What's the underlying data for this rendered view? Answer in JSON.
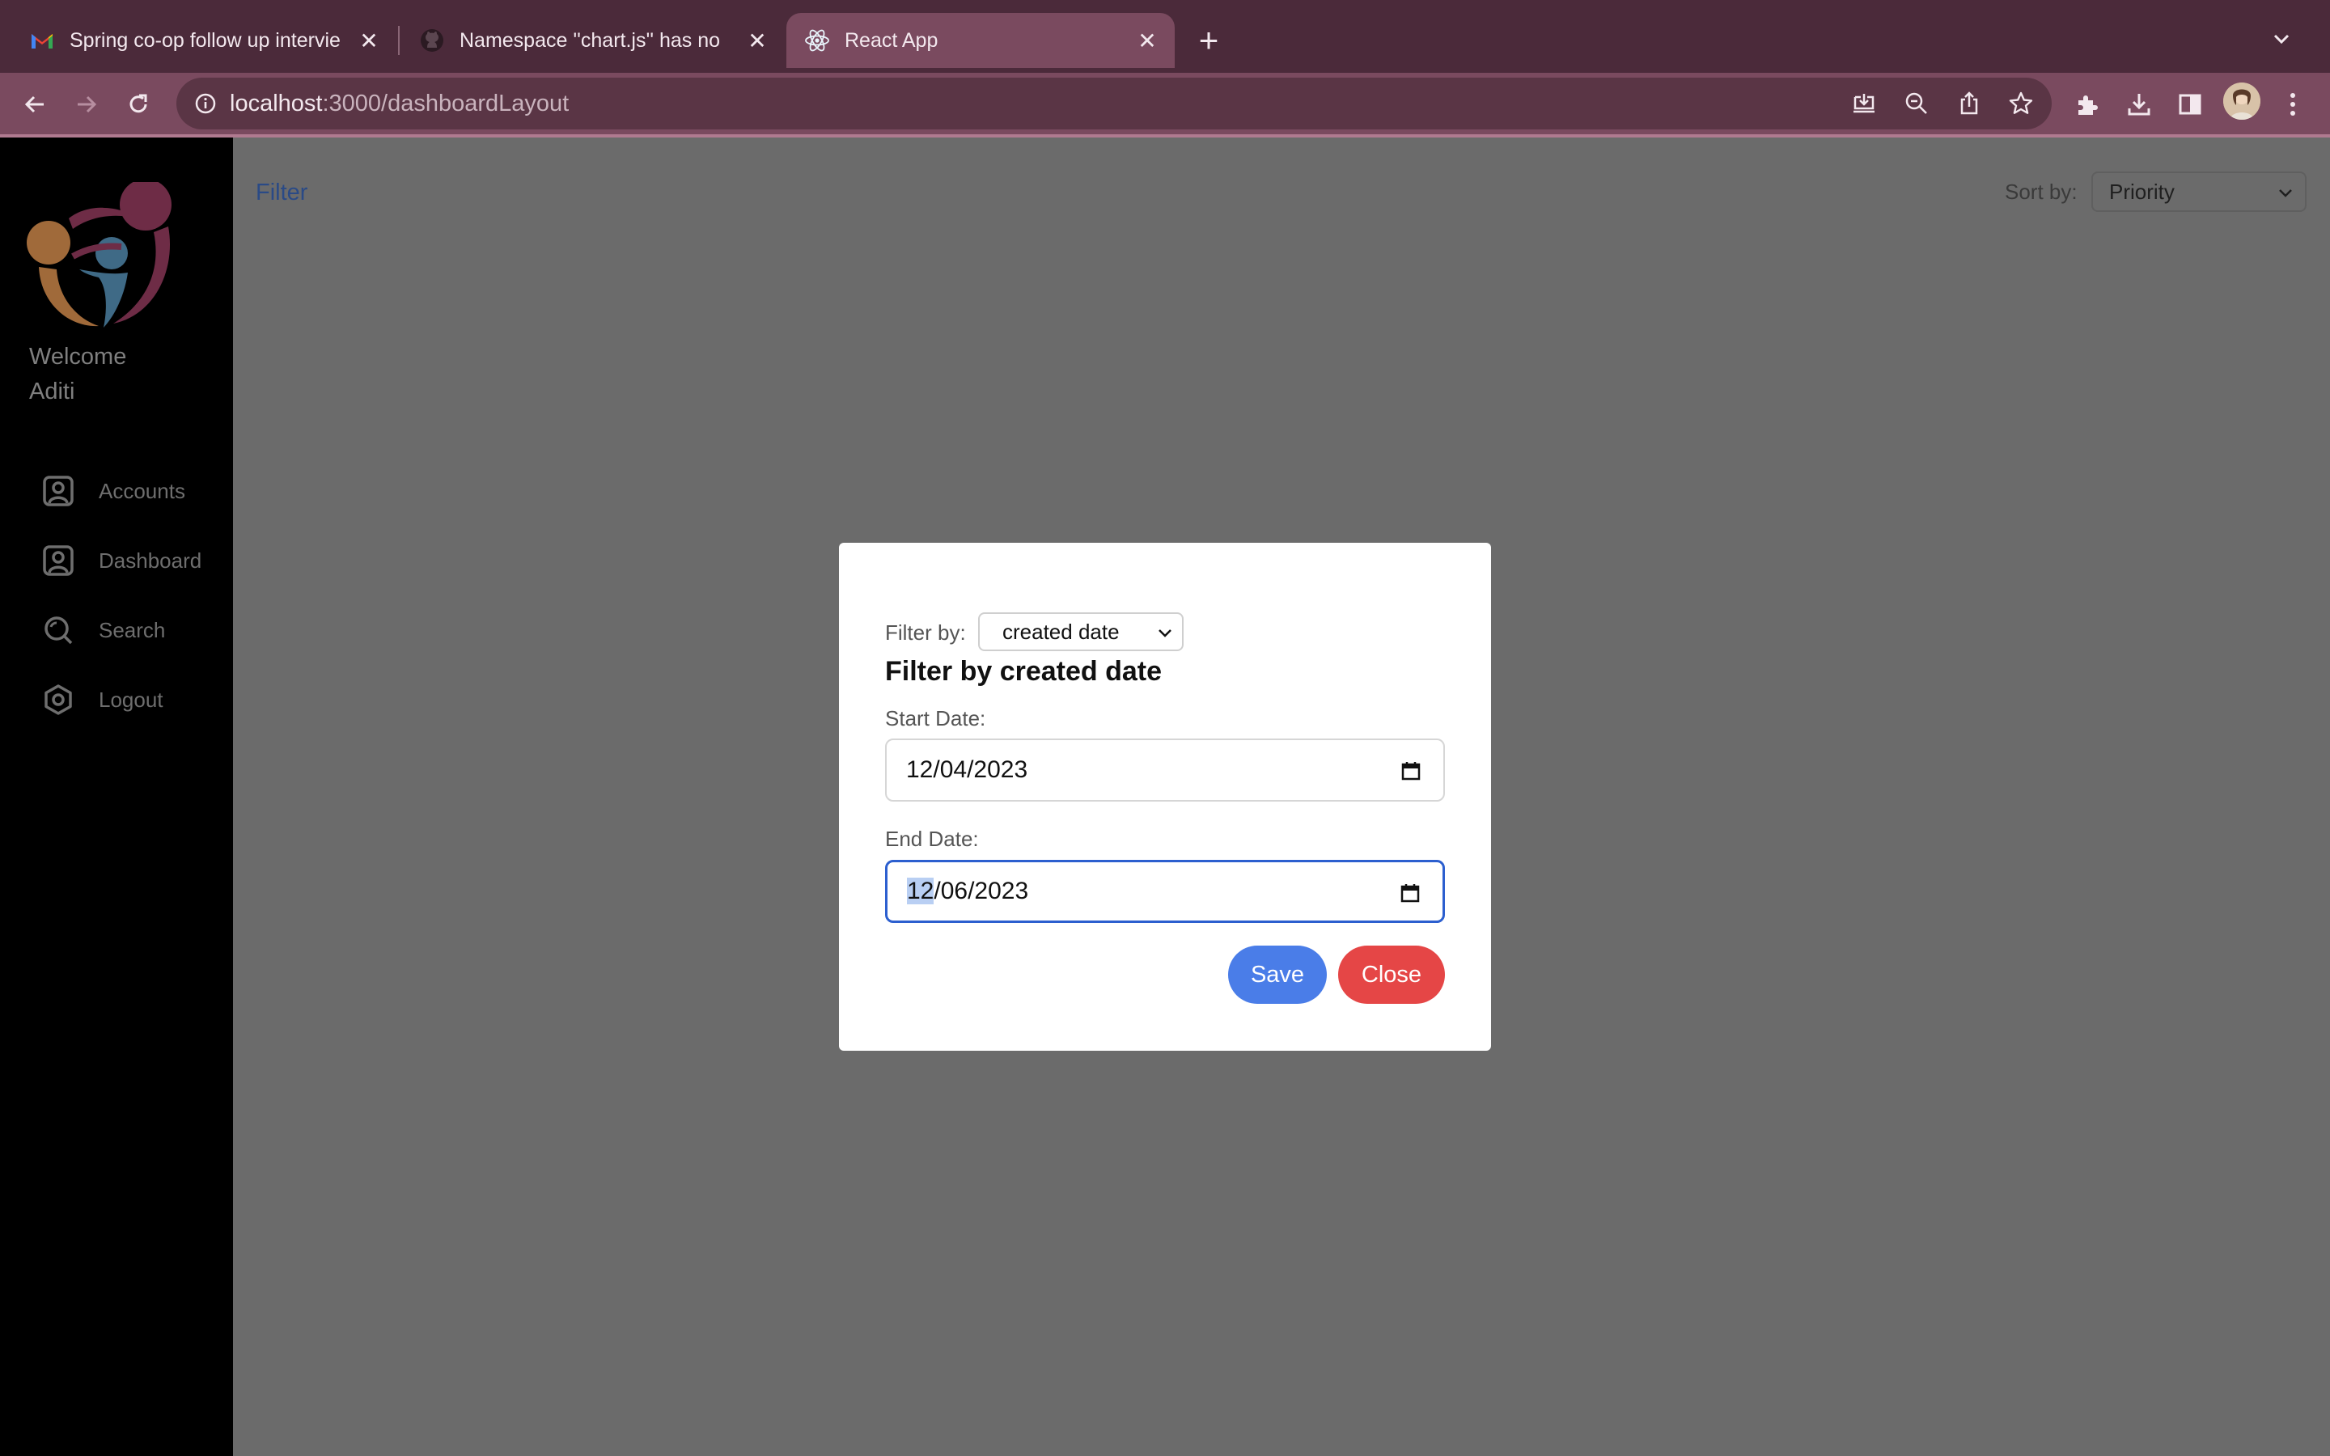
{
  "browser": {
    "tabs": [
      {
        "title": "Spring co-op follow up intervie",
        "icon": "gmail-icon",
        "active": false
      },
      {
        "title": "Namespace ''chart.js'' has no",
        "icon": "github-icon",
        "active": false
      },
      {
        "title": "React App",
        "icon": "react-icon",
        "active": true
      }
    ],
    "url_host": "localhost",
    "url_rest": ":3000/dashboardLayout",
    "colors": {
      "tabbar": "#4b2a3a",
      "toolbar": "#7a4a5f"
    }
  },
  "sidebar": {
    "welcome_line1": "Welcome",
    "welcome_line2": "Aditi",
    "items": [
      {
        "label": "Accounts",
        "icon": "user-square-icon"
      },
      {
        "label": "Dashboard",
        "icon": "user-square-icon"
      },
      {
        "label": "Search",
        "icon": "search-icon"
      },
      {
        "label": "Logout",
        "icon": "logout-icon"
      }
    ]
  },
  "main": {
    "filter_link": "Filter",
    "sort_label": "Sort by:",
    "sort_value": "Priority"
  },
  "modal": {
    "filter_by_label": "Filter by:",
    "filter_by_value": "created date",
    "heading": "Filter by created date",
    "start_label": "Start Date:",
    "start_value": "12/04/2023",
    "end_label": "End Date:",
    "end_value_selected": "12",
    "end_value_rest": "/06/2023",
    "save_label": "Save",
    "close_label": "Close",
    "colors": {
      "save": "#4a7de8",
      "close": "#e54646",
      "focus": "#2c5fcf"
    }
  }
}
